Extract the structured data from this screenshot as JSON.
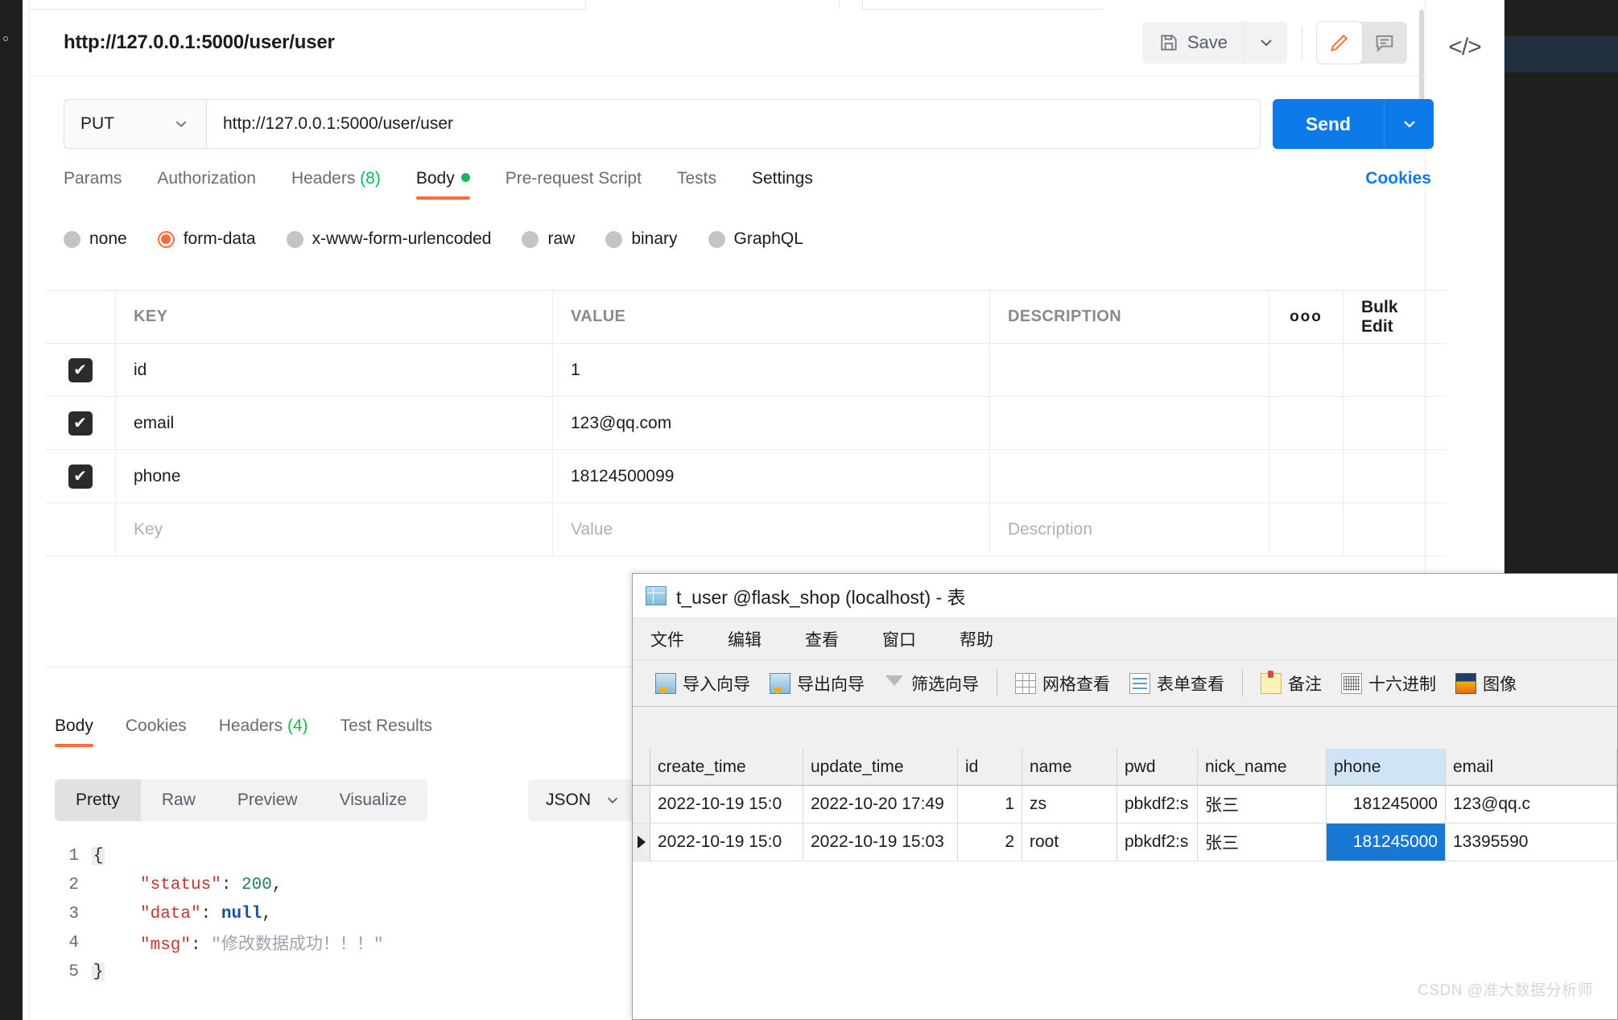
{
  "app": {
    "request_title": "http://127.0.0.1:5000/user/user",
    "save_label": "Save",
    "code_icon": "</>",
    "icons": {
      "save": "save-icon",
      "caret_down": "chevron-down-icon",
      "pencil": "pencil-icon",
      "comment": "comment-icon"
    }
  },
  "urlbar": {
    "method": "PUT",
    "url": "http://127.0.0.1:5000/user/user",
    "send_label": "Send"
  },
  "request_tabs": {
    "items": [
      {
        "label": "Params",
        "active": false
      },
      {
        "label": "Authorization",
        "active": false
      },
      {
        "label": "Headers",
        "count": "(8)",
        "active": false
      },
      {
        "label": "Body",
        "dot": true,
        "active": true
      },
      {
        "label": "Pre-request Script",
        "active": false
      },
      {
        "label": "Tests",
        "active": false
      },
      {
        "label": "Settings",
        "active": false
      }
    ],
    "cookies_label": "Cookies"
  },
  "body_types": [
    {
      "label": "none",
      "selected": false
    },
    {
      "label": "form-data",
      "selected": true
    },
    {
      "label": "x-www-form-urlencoded",
      "selected": false
    },
    {
      "label": "raw",
      "selected": false
    },
    {
      "label": "binary",
      "selected": false
    },
    {
      "label": "GraphQL",
      "selected": false
    }
  ],
  "kv_table": {
    "headers": {
      "key": "KEY",
      "value": "VALUE",
      "description": "DESCRIPTION",
      "dots": "ooo",
      "bulk_edit": "Bulk Edit"
    },
    "rows": [
      {
        "checked": true,
        "key": "id",
        "value": "1",
        "description": ""
      },
      {
        "checked": true,
        "key": "email",
        "value": "123@qq.com",
        "description": ""
      },
      {
        "checked": true,
        "key": "phone",
        "value": "18124500099",
        "description": ""
      }
    ],
    "placeholder_row": {
      "key": "Key",
      "value": "Value",
      "description": "Description"
    }
  },
  "response": {
    "tabs": [
      {
        "label": "Body",
        "active": true
      },
      {
        "label": "Cookies",
        "active": false
      },
      {
        "label": "Headers",
        "count": "(4)",
        "active": false
      },
      {
        "label": "Test Results",
        "active": false
      }
    ],
    "view_modes": [
      {
        "label": "Pretty",
        "active": true
      },
      {
        "label": "Raw",
        "active": false
      },
      {
        "label": "Preview",
        "active": false
      },
      {
        "label": "Visualize",
        "active": false
      }
    ],
    "format": "JSON",
    "code_lines": [
      {
        "no": "1",
        "fold": "{",
        "tokens": []
      },
      {
        "no": "2",
        "fold": "",
        "tokens": [
          {
            "t": "\"status\"",
            "c": "k-key"
          },
          {
            "t": ": ",
            "c": "k-pun"
          },
          {
            "t": "200",
            "c": "k-num"
          },
          {
            "t": ",",
            "c": "k-pun"
          }
        ]
      },
      {
        "no": "3",
        "fold": "",
        "tokens": [
          {
            "t": "\"data\"",
            "c": "k-key"
          },
          {
            "t": ": ",
            "c": "k-pun"
          },
          {
            "t": "null",
            "c": "k-null"
          },
          {
            "t": ",",
            "c": "k-pun"
          }
        ]
      },
      {
        "no": "4",
        "fold": "",
        "tokens": [
          {
            "t": "\"msg\"",
            "c": "k-key"
          },
          {
            "t": ": ",
            "c": "k-pun"
          },
          {
            "t": "\"修改数据成功！！！\"",
            "c": "k-str"
          }
        ]
      },
      {
        "no": "5",
        "fold": "}",
        "tokens": []
      }
    ]
  },
  "navicat": {
    "title": "t_user @flask_shop (localhost) - 表",
    "menu": [
      "文件",
      "编辑",
      "查看",
      "窗口",
      "帮助"
    ],
    "toolbar": [
      {
        "label": "导入向导",
        "icon": "import-wizard-icon"
      },
      {
        "label": "导出向导",
        "icon": "export-wizard-icon"
      },
      {
        "label": "筛选向导",
        "icon": "filter-wizard-icon"
      },
      {
        "label": "网格查看",
        "icon": "grid-view-icon"
      },
      {
        "label": "表单查看",
        "icon": "form-view-icon"
      },
      {
        "label": "备注",
        "icon": "memo-icon"
      },
      {
        "label": "十六进制",
        "icon": "hex-icon"
      },
      {
        "label": "图像",
        "icon": "image-icon"
      }
    ],
    "grid": {
      "columns": [
        "create_time",
        "update_time",
        "id",
        "name",
        "pwd",
        "nick_name",
        "phone",
        "email"
      ],
      "highlighted_column": "phone",
      "rows": [
        {
          "selected": false,
          "create_time": "2022-10-19 15:0",
          "update_time": "2022-10-20 17:49",
          "id": "1",
          "name": "zs",
          "pwd": "pbkdf2:s",
          "nick_name": "张三",
          "phone": "181245000",
          "email": "123@qq.c"
        },
        {
          "selected": true,
          "create_time": "2022-10-19 15:0",
          "update_time": "2022-10-19 15:03",
          "id": "2",
          "name": "root",
          "pwd": "pbkdf2:s",
          "nick_name": "张三",
          "phone": "181245000",
          "email": "13395590"
        }
      ],
      "selected_cell": "phone"
    }
  },
  "watermark": "CSDN @准大数据分析师"
}
